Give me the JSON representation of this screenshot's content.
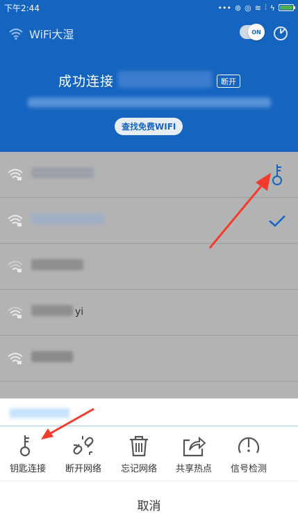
{
  "status_bar": {
    "time": "下午2:44",
    "icons": [
      "more-dots-icon",
      "alarm-icon",
      "signal-icon",
      "wifi-icon",
      "network-4g-icon",
      "charging-icon",
      "battery-icon"
    ]
  },
  "app": {
    "title": "WiFi大湿",
    "toggle_label": "ON"
  },
  "connection": {
    "status_prefix": "成功连接",
    "disconnect_label": "断开",
    "find_free_wifi_label": "查找免费WIFI"
  },
  "networks": [
    {
      "name": "",
      "icon": "wifi-locked-icon",
      "action": "key-icon"
    },
    {
      "name": "",
      "icon": "wifi-locked-icon",
      "action": "check-icon"
    },
    {
      "name": "",
      "icon": "wifi-locked-icon",
      "action": ""
    },
    {
      "name": "yi",
      "icon": "wifi-locked-icon",
      "action": ""
    },
    {
      "name": "",
      "icon": "wifi-locked-icon",
      "action": ""
    }
  ],
  "sheet": {
    "actions": [
      {
        "label": "钥匙连接",
        "icon": "key-icon"
      },
      {
        "label": "断开网络",
        "icon": "broken-link-icon"
      },
      {
        "label": "忘记网络",
        "icon": "trash-icon"
      },
      {
        "label": "共享热点",
        "icon": "share-icon"
      },
      {
        "label": "信号检测",
        "icon": "signal-check-icon"
      }
    ],
    "cancel_label": "取消"
  },
  "colors": {
    "brand_blue": "#1565c0",
    "overlay_gray": "#b3b3b3",
    "annotation_red": "#f23b2d"
  }
}
